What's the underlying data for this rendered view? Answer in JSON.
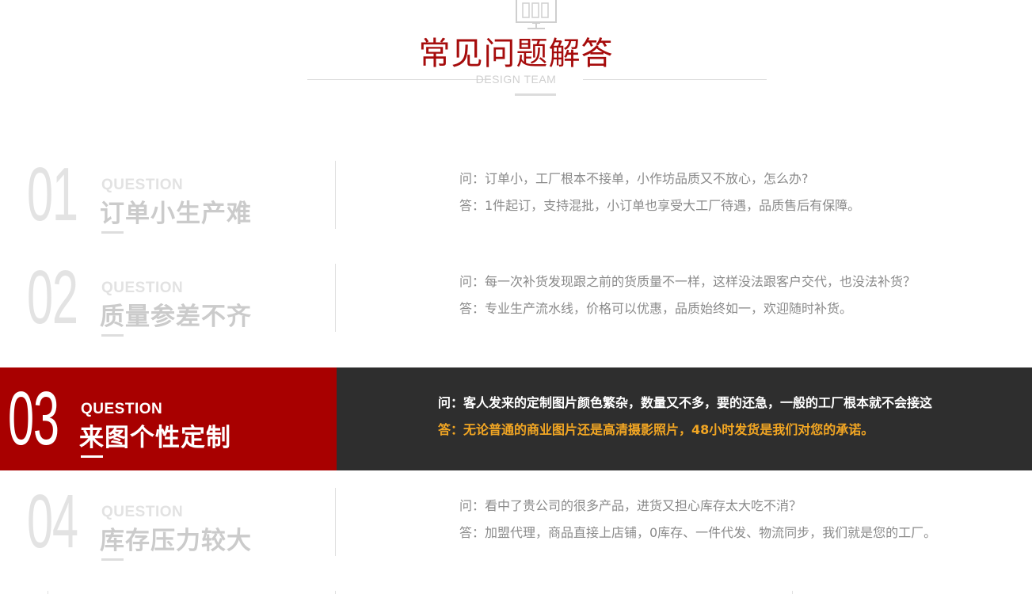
{
  "header": {
    "icon": "monitor-icon",
    "title": "常见问题解答",
    "subtitle": "DESIGN TEAM"
  },
  "colors": {
    "accent_red": "#a80000",
    "dark_panel": "#2e2e2e",
    "answer_highlight": "#f2a623"
  },
  "faq": [
    {
      "number": "01",
      "label": "QUESTION",
      "heading": "订单小生产难",
      "question": "问：订单小，工厂根本不接单，小作坊品质又不放心，怎么办?",
      "answer": "答：1件起订，支持混批，小订单也享受大工厂待遇，品质售后有保障。"
    },
    {
      "number": "02",
      "label": "QUESTION",
      "heading": "质量参差不齐",
      "question": "问：每一次补货发现跟之前的货质量不一样，这样没法跟客户交代，也没法补货？",
      "answer": "答：专业生产流水线，价格可以优惠，品质始终如一，欢迎随时补货。"
    },
    {
      "number": "03",
      "label": "QUESTION",
      "heading": "来图个性定制",
      "question": "问：客人发来的定制图片颜色繁杂，数量又不多，要的还急，一般的工厂根本就不会接这",
      "answer": "答：无论普通的商业图片还是高清摄影照片，48小时发货是我们对您的承诺。"
    },
    {
      "number": "04",
      "label": "QUESTION",
      "heading": "库存压力较大",
      "question": "问：看中了贵公司的很多产品，进货又担心库存太大吃不消？",
      "answer": "答：加盟代理，商品直接上店铺，0库存、一件代发、物流同步，我们就是您的工厂。"
    }
  ]
}
